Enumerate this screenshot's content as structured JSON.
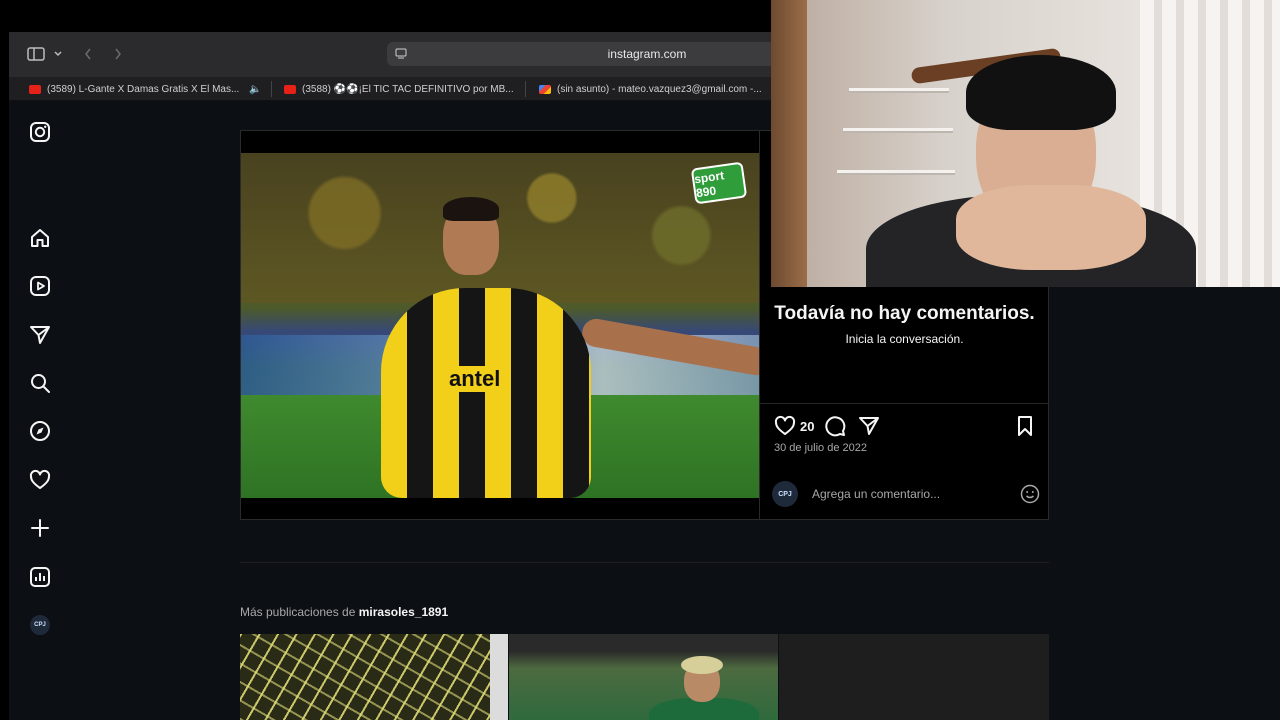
{
  "browser": {
    "url": "instagram.com",
    "tabs": [
      {
        "title": "(3589) L-Gante X Damas Gratis X El Mas...",
        "favicon": "youtube",
        "color": "#e62117"
      },
      {
        "title": "(3588) ⚽⚽¡El TIC TAC DEFINITIVO por MB...",
        "favicon": "youtube",
        "color": "#e62117"
      },
      {
        "title": "(sin asunto) - mateo.vazquez3@gmail.com -...",
        "favicon": "gmail",
        "color": "#ea4335"
      }
    ]
  },
  "sidebar": {
    "items": [
      {
        "icon": "instagram-icon"
      },
      {
        "icon": "home-icon"
      },
      {
        "icon": "reels-icon"
      },
      {
        "icon": "send-icon"
      },
      {
        "icon": "search-icon"
      },
      {
        "icon": "explore-icon"
      },
      {
        "icon": "heart-icon"
      },
      {
        "icon": "plus-icon"
      },
      {
        "icon": "insights-icon"
      }
    ],
    "avatar_text": "CPJ"
  },
  "post": {
    "image_logo": "sport 890",
    "jersey_text": "antel",
    "no_comments_title": "Todavía no hay comentarios.",
    "no_comments_subtitle": "Inicia la conversación.",
    "likes": "20",
    "date": "30 de julio de 2022",
    "comment_placeholder": "Agrega un comentario...",
    "commenter_avatar_text": "CPJ"
  },
  "more_posts": {
    "prefix": "Más publicaciones de",
    "username": "mirasoles_1891"
  }
}
